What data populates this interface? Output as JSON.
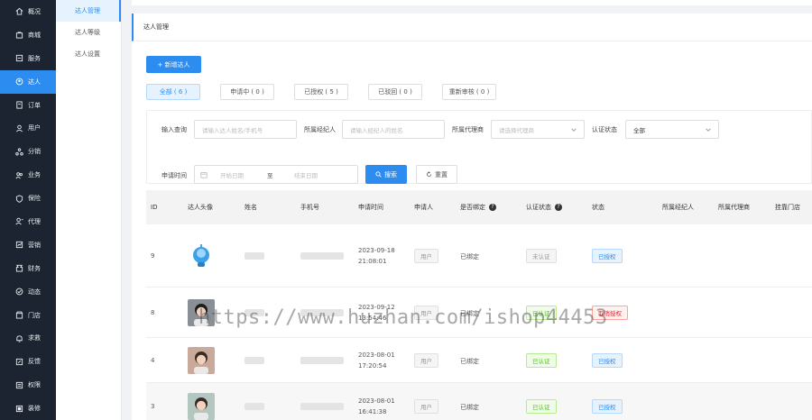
{
  "nav": {
    "items": [
      {
        "label": "概况",
        "icon": "home-icon"
      },
      {
        "label": "商城",
        "icon": "store-icon"
      },
      {
        "label": "服务",
        "icon": "service-icon"
      },
      {
        "label": "达人",
        "icon": "talent-icon",
        "active": true
      },
      {
        "label": "订单",
        "icon": "order-icon"
      },
      {
        "label": "用户",
        "icon": "user-icon"
      },
      {
        "label": "分销",
        "icon": "distribution-icon"
      },
      {
        "label": "业务",
        "icon": "business-icon"
      },
      {
        "label": "保险",
        "icon": "insurance-icon"
      },
      {
        "label": "代理",
        "icon": "agent-icon"
      },
      {
        "label": "营销",
        "icon": "marketing-icon"
      },
      {
        "label": "财务",
        "icon": "finance-icon"
      },
      {
        "label": "动态",
        "icon": "dynamic-icon"
      },
      {
        "label": "门店",
        "icon": "shop-icon"
      },
      {
        "label": "求救",
        "icon": "alarm-icon"
      },
      {
        "label": "反馈",
        "icon": "feedback-icon"
      },
      {
        "label": "权限",
        "icon": "permission-icon"
      },
      {
        "label": "装修",
        "icon": "decoration-icon"
      }
    ]
  },
  "subnav": {
    "items": [
      {
        "label": "达人管理",
        "active": true
      },
      {
        "label": "达人等级"
      },
      {
        "label": "达人设置"
      }
    ]
  },
  "page": {
    "title": "达人管理",
    "new_button": "+ 新增达人"
  },
  "tabs": [
    {
      "label": "全部 ( 6 )",
      "active": true
    },
    {
      "label": "申请中 ( 0 )"
    },
    {
      "label": "已授权 ( 5 )"
    },
    {
      "label": "已驳回 ( 0 )"
    },
    {
      "label": "重新审核 ( 0 )"
    }
  ],
  "filter": {
    "search_label": "输入查询",
    "search_placeholder": "请输入达人姓名/手机号",
    "broker_label": "所属经纪人",
    "broker_placeholder": "请输入经纪人的姓名",
    "agent_label": "所属代理商",
    "agent_placeholder": "请选择代理商",
    "status_label": "认证状态",
    "status_value": "全部",
    "time_label": "申请时间",
    "date_start_placeholder": "开始日期",
    "date_sep": "至",
    "date_end_placeholder": "结束日期",
    "search_button": "搜索",
    "reset_button": "重置"
  },
  "table": {
    "columns": [
      "ID",
      "达人头像",
      "姓名",
      "手机号",
      "申请时间",
      "申请人",
      "是否绑定",
      "认证状态",
      "状态",
      "所属经纪人",
      "所属代理商",
      "挂靠门店"
    ],
    "rows": [
      {
        "id": "9",
        "date": "2023-09-18",
        "time": "21:08:01",
        "applicant": "用户",
        "bound": "已绑定",
        "cert": "未认证",
        "cert_color": "gray",
        "status": "已授权",
        "status_color": "blue",
        "avatar": "robot"
      },
      {
        "id": "8",
        "date": "2023-09-12",
        "time": "13:54:46",
        "applicant": "用户",
        "bound": "已绑定",
        "cert": "已认证",
        "cert_color": "green",
        "status": "取消授权",
        "status_color": "red",
        "avatar": "photo-a"
      },
      {
        "id": "4",
        "date": "2023-08-01",
        "time": "17:20:54",
        "applicant": "用户",
        "bound": "已绑定",
        "cert": "已认证",
        "cert_color": "green",
        "status": "已授权",
        "status_color": "blue",
        "avatar": "photo-b"
      },
      {
        "id": "3",
        "date": "2023-08-01",
        "time": "16:41:38",
        "applicant": "用户",
        "bound": "已绑定",
        "cert": "已认证",
        "cert_color": "green",
        "status": "已授权",
        "status_color": "blue",
        "avatar": "photo-c"
      }
    ]
  },
  "watermark": "https://www.huzhan.com/ishop44453",
  "colors": {
    "primary": "#2d8cf0",
    "nav_bg": "#1b2430"
  }
}
